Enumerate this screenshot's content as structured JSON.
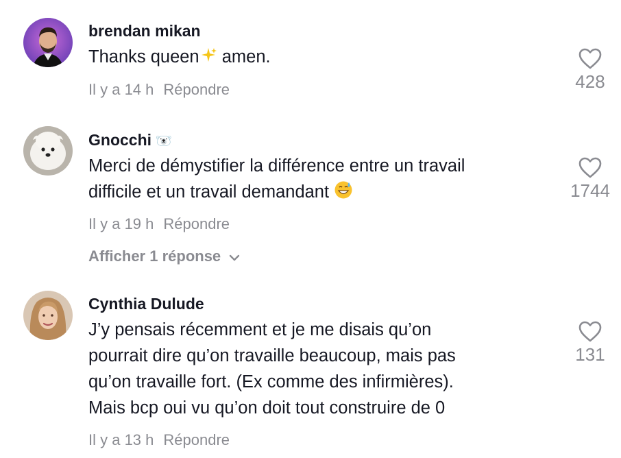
{
  "comments": [
    {
      "author": "brendan mikan",
      "author_emoji": "",
      "text_before_emoji": "Thanks queen",
      "text_after_emoji": " amen.",
      "emoji": "sparkles-emoji",
      "time": "Il y a 14 h",
      "reply_label": "Répondre",
      "likes": "428"
    },
    {
      "author": "Gnocchi",
      "author_emoji": "🐻‍❄️",
      "text_line1": "Merci de démystifier la différence entre un travail",
      "text_line2": "difficile et un travail demandant ",
      "emoji": "grinning-sweat-emoji",
      "time": "Il y a 19 h",
      "reply_label": "Répondre",
      "likes": "1744",
      "show_replies": "Afficher 1 réponse"
    },
    {
      "author": "Cynthia Dulude",
      "author_emoji": "",
      "text_lines": [
        "J’y pensais récemment et je me disais qu’on",
        "pourrait dire qu’on travaille beaucoup, mais pas",
        "qu’on travaille fort. (Ex comme des infirmières).",
        "Mais bcp oui vu qu’on doit tout construire de 0"
      ],
      "time": "Il y a 13 h",
      "reply_label": "Répondre",
      "likes": "131"
    }
  ],
  "colors": {
    "text": "#161823",
    "muted": "#8a8b91"
  },
  "icons": [
    "heart-outline-icon",
    "chevron-down-icon"
  ]
}
